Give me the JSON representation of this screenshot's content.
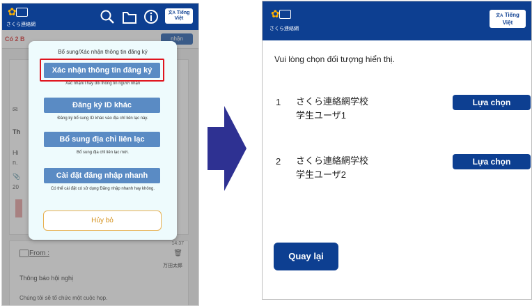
{
  "left": {
    "logo_text": "さくら連絡網",
    "lang_button": {
      "line1": "Tiếng",
      "line2": "Việt"
    },
    "notice": {
      "text": "Có 2 B",
      "button": "nhận"
    },
    "background": {
      "peek_1": "Th",
      "peek_2": "Hi",
      "peek_3": "n.",
      "peek_4": "20"
    },
    "message": {
      "time": "14:37",
      "from_label": "From :",
      "author": "万田太郎",
      "title": "Thông báo hội nghị",
      "body": "Chúng tôi sẽ tổ chức một cuộc họp."
    },
    "modal": {
      "title": "Bổ sung/Xác nhận thông tin đăng ký",
      "buttons": [
        {
          "label": "Xác nhận thông tin đăng ký",
          "desc": "Xác nhận/Thay đổi thông tin người nhận"
        },
        {
          "label": "Đăng ký ID khác",
          "desc": "Đăng ký bổ sung ID khác vào địa chỉ liên lạc này."
        },
        {
          "label": "Bổ sung địa chỉ liên lạc",
          "desc": "Bổ sung địa chỉ liên lạc mới."
        },
        {
          "label": "Cài đặt đăng nhập nhanh",
          "desc": "Có thể cài đặt có sử dụng Đăng nhập nhanh hay không."
        }
      ],
      "cancel": "Hủy bỏ"
    }
  },
  "right": {
    "logo_text": "さくら連絡網",
    "lang_button": {
      "line1": "Tiếng",
      "line2": "Việt"
    },
    "prompt": "Vui lòng chọn đối tượng hiển thị.",
    "options": [
      {
        "num": "1",
        "school": "さくら連絡網学校",
        "user": "学生ユーザ1",
        "button": "Lựa chọn"
      },
      {
        "num": "2",
        "school": "さくら連絡網学校",
        "user": "学生ユーザ2",
        "button": "Lựa chọn"
      }
    ],
    "back": "Quay lại"
  },
  "colors": {
    "header": "#0d3f91",
    "modal_button": "#5a8bc4",
    "highlight": "#e0141e",
    "cancel": "#d4901a"
  }
}
